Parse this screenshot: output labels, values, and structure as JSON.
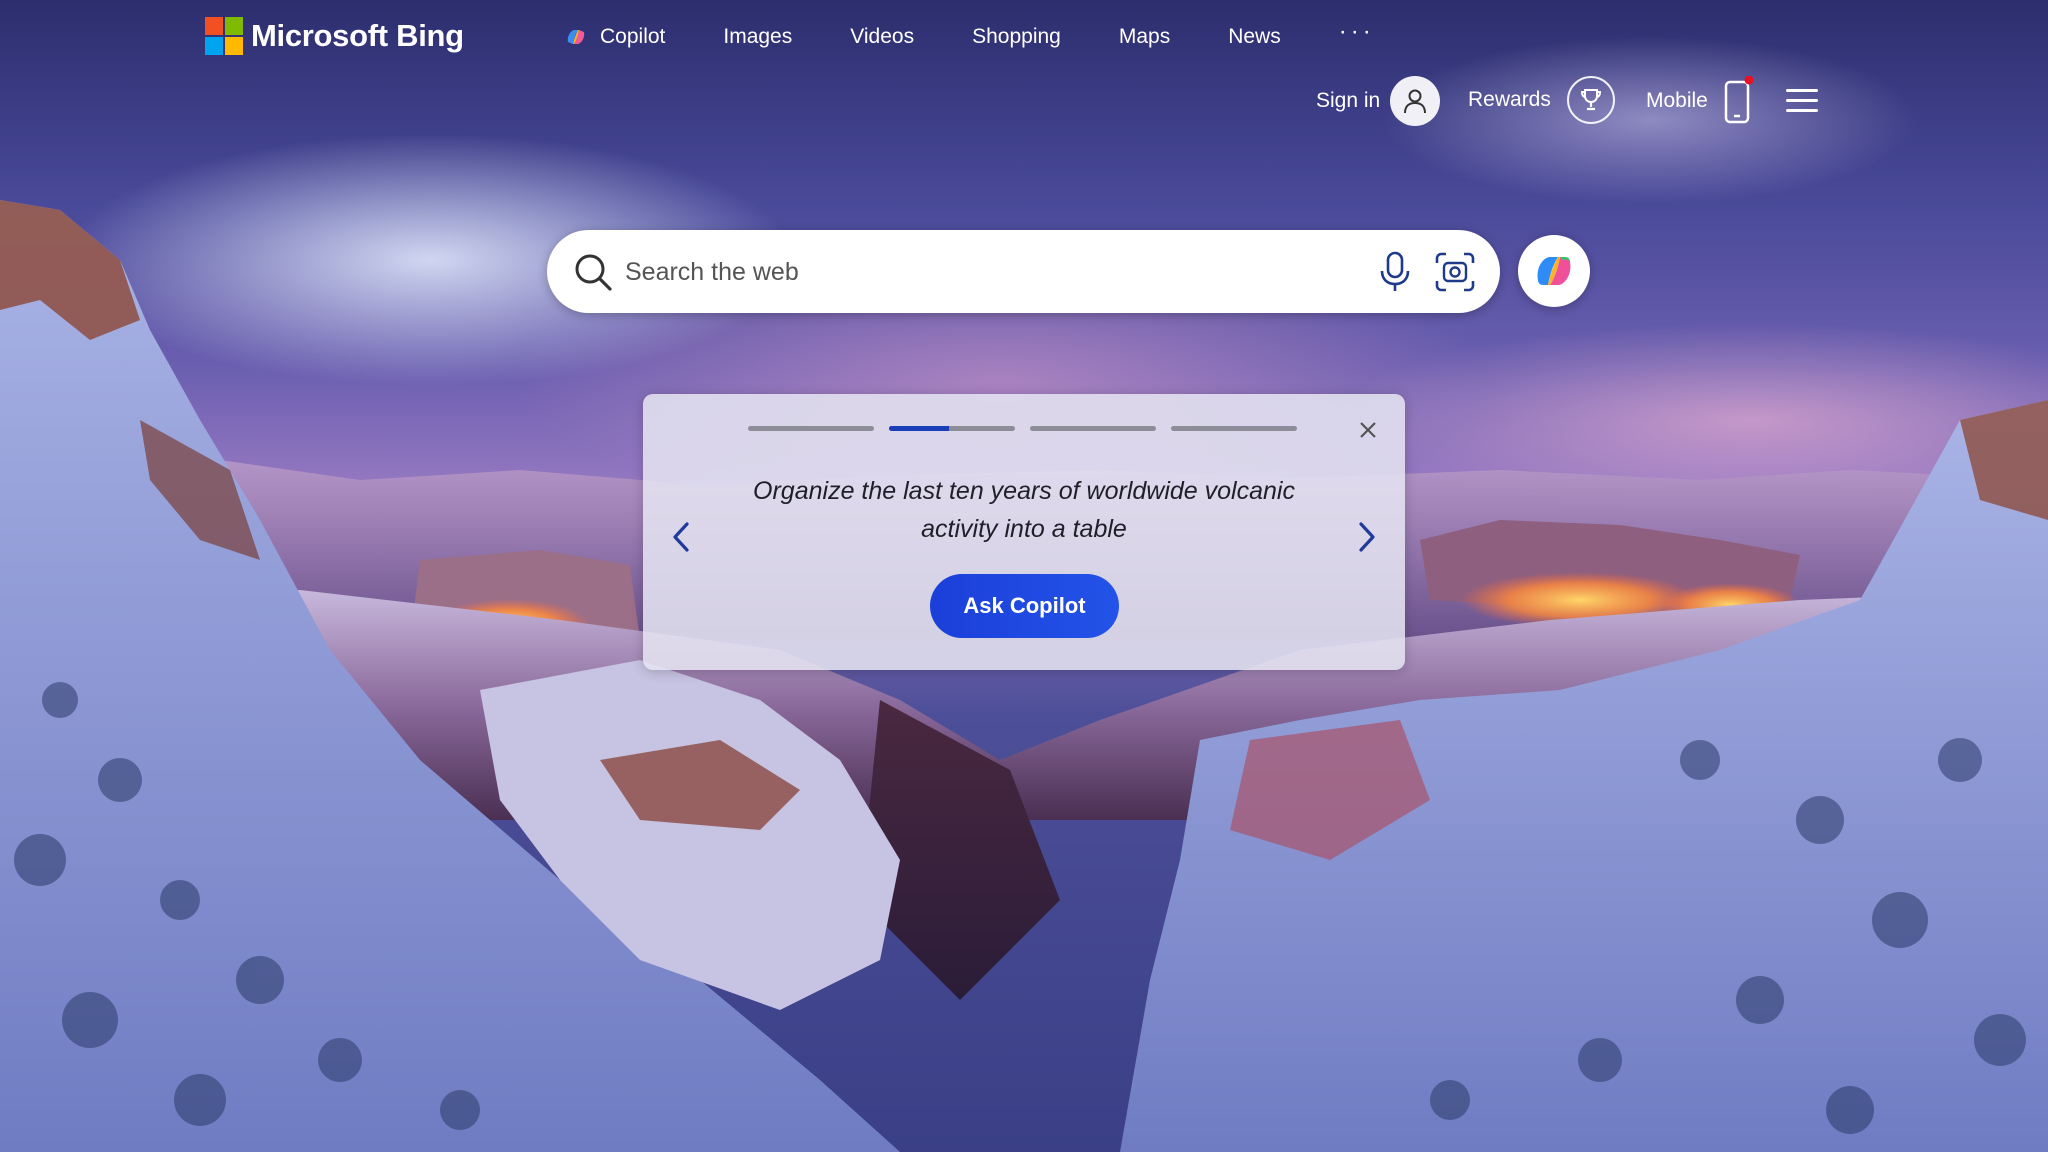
{
  "header": {
    "logo_text": "Microsoft Bing",
    "nav": [
      {
        "label": "Copilot",
        "icon": "copilot-icon"
      },
      {
        "label": "Images"
      },
      {
        "label": "Videos"
      },
      {
        "label": "Shopping"
      },
      {
        "label": "Maps"
      },
      {
        "label": "News"
      }
    ],
    "more_label": "···",
    "sign_in_label": "Sign in",
    "rewards_label": "Rewards",
    "mobile_label": "Mobile"
  },
  "search": {
    "placeholder": "Search the web",
    "value": ""
  },
  "prompt_card": {
    "text": "Organize the last ten years of worldwide volcanic activity into a table",
    "button_label": "Ask Copilot",
    "progress": [
      0,
      0.48,
      0,
      0
    ],
    "active_index": 1
  },
  "colors": {
    "accent": "#1a3db8",
    "button": "#2353e8",
    "logo_red": "#f25022",
    "logo_green": "#7fba00",
    "logo_blue": "#00a4ef",
    "logo_yellow": "#ffb900",
    "notification_dot": "#e81123"
  }
}
